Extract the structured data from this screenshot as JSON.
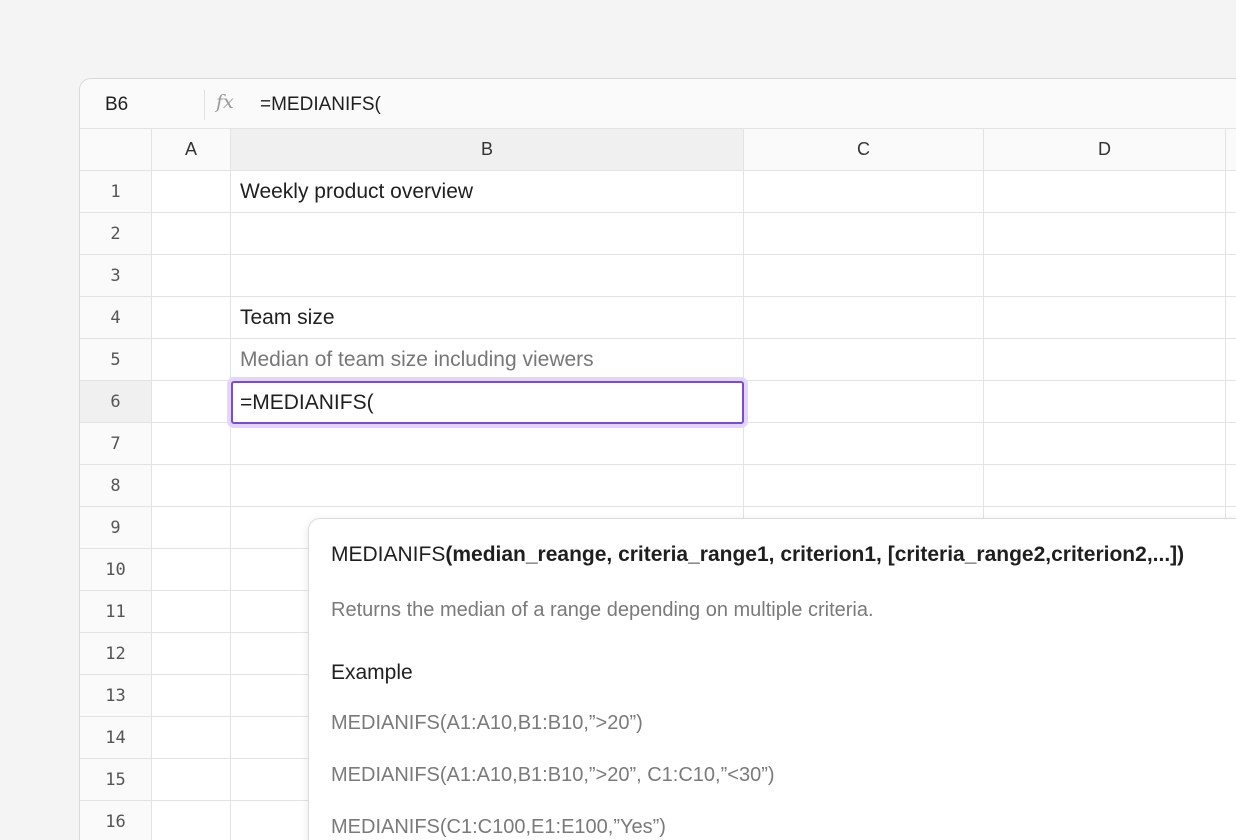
{
  "formula_bar": {
    "cell_ref": "B6",
    "fx_label": "fx",
    "formula": "=MEDIANIFS("
  },
  "columns": [
    "A",
    "B",
    "C",
    "D"
  ],
  "rows": [
    "1",
    "2",
    "3",
    "4",
    "5",
    "6",
    "7",
    "8",
    "9",
    "10",
    "11",
    "12",
    "13",
    "14",
    "15",
    "16"
  ],
  "cells": {
    "B1": "Weekly product overview",
    "B4": "Team size",
    "B5": "Median of team size including viewers",
    "B6": "=MEDIANIFS("
  },
  "active_cell": "B6",
  "accent_color": "#7b4ad6",
  "autocomplete": {
    "function_name": "MEDIANIFS",
    "signature_args": "(median_reange, criteria_range1, criterion1, [criteria_range2,criterion2,...])",
    "description": "Returns the median of a range depending on multiple criteria.",
    "example_title": "Example",
    "examples": [
      "MEDIANIFS(A1:A10,B1:B10,”>20”)",
      "MEDIANIFS(A1:A10,B1:B10,”>20”, C1:C10,”<30”)",
      "MEDIANIFS(C1:C100,E1:E100,”Yes”)"
    ]
  }
}
